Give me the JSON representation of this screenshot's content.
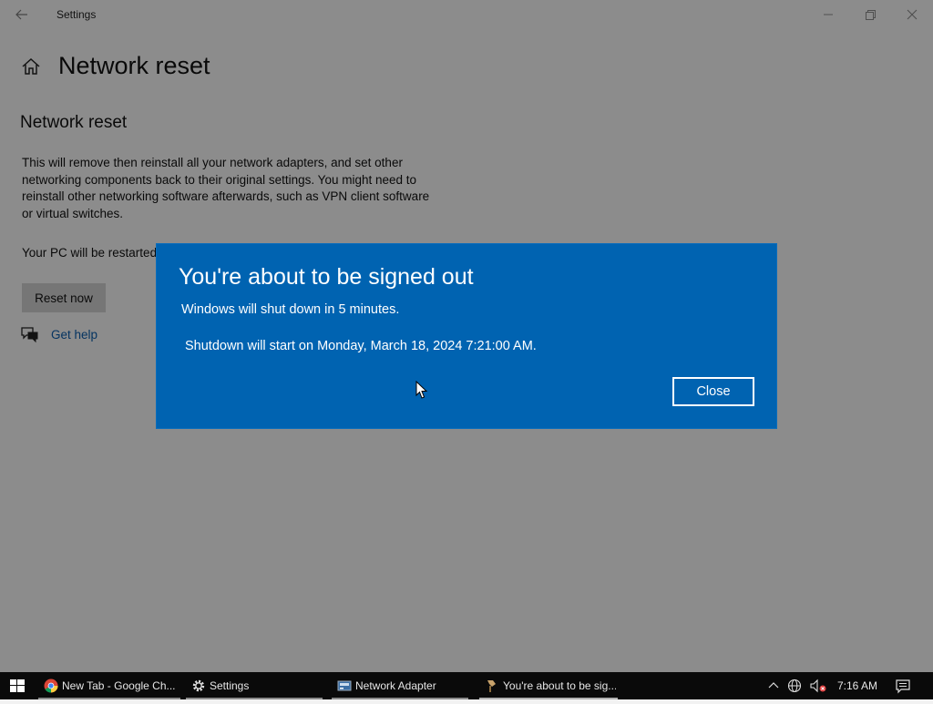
{
  "window": {
    "title": "Settings"
  },
  "page": {
    "title": "Network reset",
    "section_title": "Network reset",
    "description": "This will remove then reinstall all your network adapters, and set other networking components back to their original settings. You might need to reinstall other networking software afterwards, such as VPN client software or virtual switches.",
    "restart_note": "Your PC will be restarted",
    "reset_button": "Reset now",
    "help_link": "Get help"
  },
  "dialog": {
    "title": "You're about to be signed out",
    "line1": "Windows will shut down in 5 minutes.",
    "line2": "Shutdown will start on Monday, March 18, 2024 7:21:00 AM.",
    "close_button": "Close"
  },
  "taskbar": {
    "items": [
      {
        "label": "New Tab - Google Ch...",
        "icon": "chrome-icon"
      },
      {
        "label": "Settings",
        "icon": "gear-icon"
      },
      {
        "label": "Network Adapter",
        "icon": "network-adapter-icon"
      },
      {
        "label": "You're about to be sig...",
        "icon": "shutdown-dialog-icon"
      }
    ],
    "clock": "7:16 AM"
  },
  "colors": {
    "dialog_bg": "#0063b1",
    "link": "#0a5aa8",
    "taskbar_bg": "#0a0a0a"
  }
}
